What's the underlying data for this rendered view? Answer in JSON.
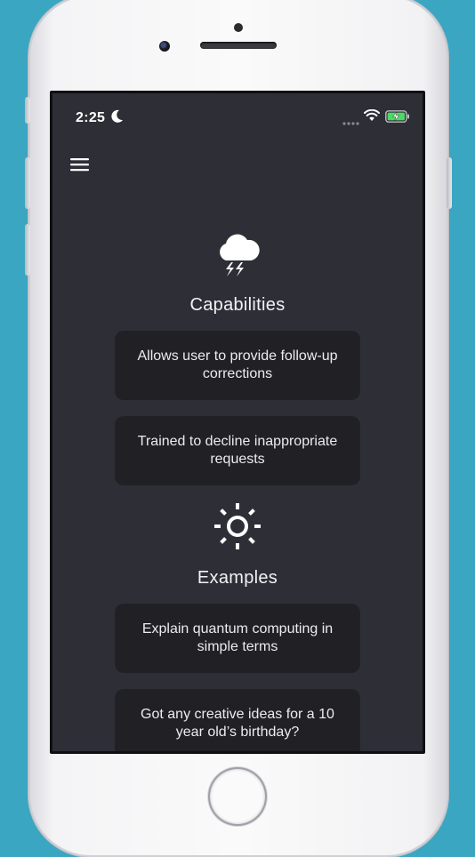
{
  "status_bar": {
    "time": "2:25",
    "icons": [
      "moon-icon",
      "signal-icon",
      "wifi-icon",
      "battery-charging-icon"
    ],
    "battery_color": "#4cd964"
  },
  "nav": {
    "menu_icon": "hamburger-menu-icon"
  },
  "capabilities": {
    "icon": "thunderstorm-cloud-icon",
    "title": "Capabilities",
    "items": [
      "Allows user to provide follow-up corrections",
      "Trained to decline inappropriate requests"
    ]
  },
  "examples": {
    "icon": "sun-icon",
    "title": "Examples",
    "items": [
      "Explain quantum computing in simple terms",
      "Got any creative ideas for a 10 year old’s birthday?"
    ]
  },
  "colors": {
    "background": "#2e2e37",
    "card": "#212125",
    "text": "#ececef",
    "device_backdrop": "#3aa6c2"
  }
}
